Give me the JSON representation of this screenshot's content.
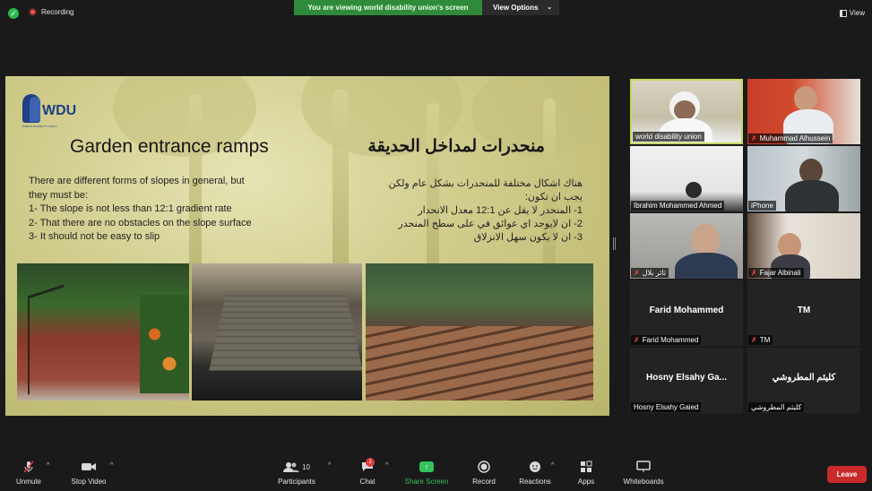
{
  "topbar": {
    "recording_label": "Recording",
    "viewing_banner": "You are viewing world disability union's screen",
    "view_options_label": "View Options",
    "view_label": "View"
  },
  "slide": {
    "logo_text": "WDU",
    "logo_subtitle": "WORLD DISABILITY UNION",
    "title_en": "Garden entrance ramps",
    "title_ar": "منحدرات لمداخل الحديقة",
    "body_en": [
      "There are different forms of slopes in general, but",
      "they must be:",
      "1- The slope is not less than 12:1 gradient rate",
      "2- That there are no obstacles on the slope surface",
      "3- It should not be easy to slip"
    ],
    "body_ar": [
      "هناك اشكال مختلفة للمنحدرات بشكل عام ولكن",
      "يجب ان تكون:",
      "1- المنحدر لا يقل عن 12:1 معدل الانحدار",
      "2- ان لايوجد اي عوائق في على سطح المنحدر",
      "3- ان لا يكون سهل الانزلاق"
    ]
  },
  "participants": [
    {
      "name": "world disability union",
      "muted": false
    },
    {
      "name": "Muhammad Alhussein",
      "muted": true
    },
    {
      "name": "Ibrahim Mohammed Ahmed",
      "muted": false
    },
    {
      "name": "iPhone",
      "muted": false
    },
    {
      "name": "ثائر بلال",
      "muted": true
    },
    {
      "name": "Fajar Albinali",
      "muted": true
    },
    {
      "name": "Farid Mohammed",
      "display": "Farid Mohammed",
      "muted": true
    },
    {
      "name": "TM",
      "display": "TM",
      "muted": true
    },
    {
      "name": "Hosny Elsahy Gaied",
      "display": "Hosny Elsahy Ga...",
      "muted": false
    },
    {
      "name": "كليثم المطروشي",
      "display": "كليثم المطروشي",
      "muted": false
    }
  ],
  "toolbar": {
    "unmute": "Unmute",
    "stop_video": "Stop Video",
    "participants": "Participants",
    "participants_count": "10",
    "chat": "Chat",
    "chat_badge": "1",
    "share_screen": "Share Screen",
    "record": "Record",
    "reactions": "Reactions",
    "apps": "Apps",
    "whiteboards": "Whiteboards",
    "leave": "Leave"
  },
  "colors": {
    "share_green": "#35c25a",
    "leave_red": "#c92a2a",
    "active_speaker_border": "#c7d860",
    "banner_green": "#2f8a3a"
  }
}
